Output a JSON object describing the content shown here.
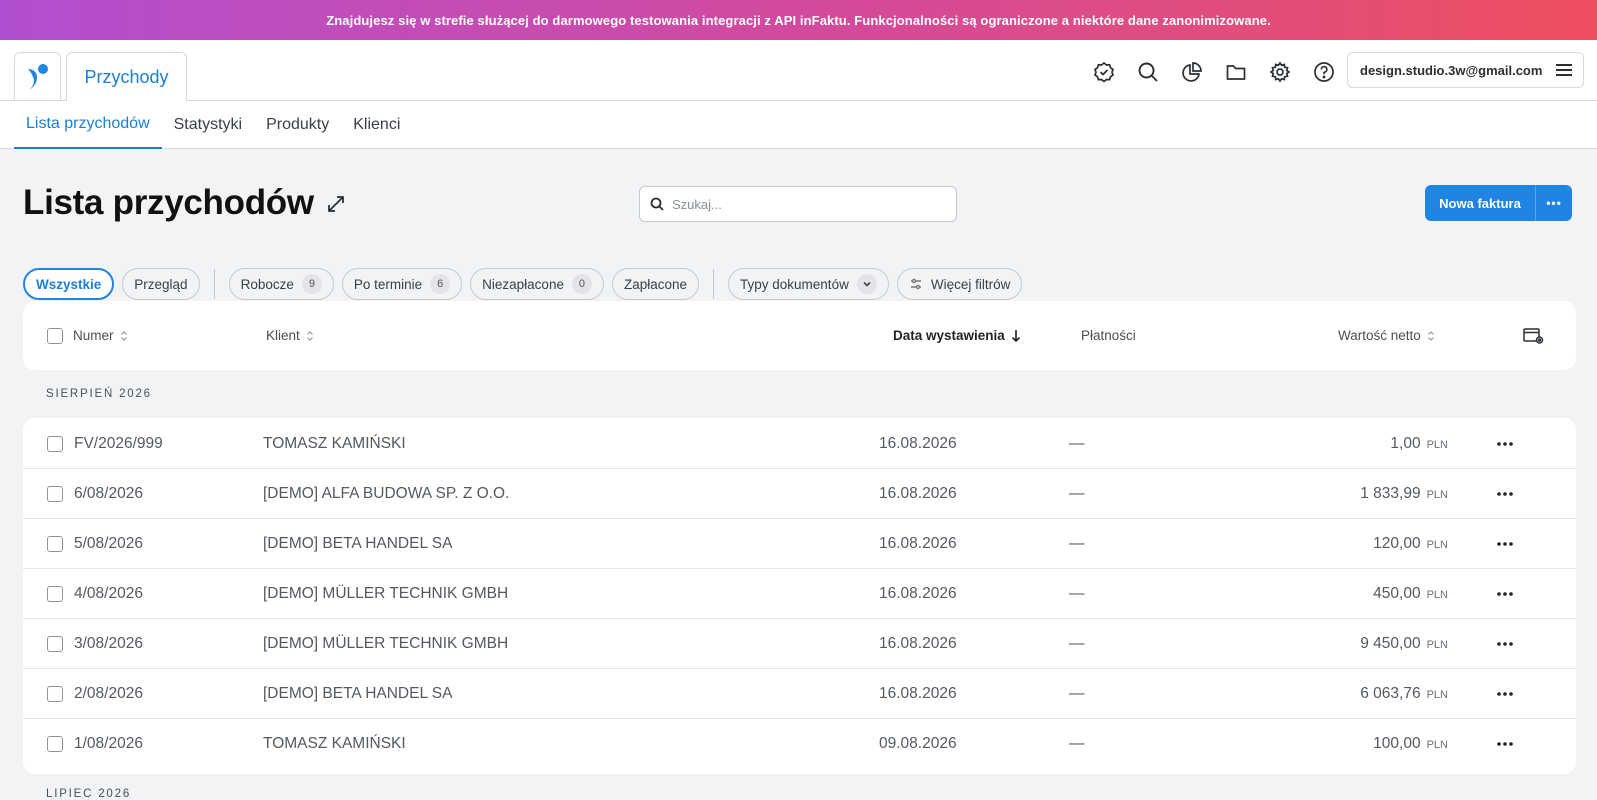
{
  "banner": {
    "text": "Znajdujesz się w strefie służącej do darmowego testowania integracji z API inFaktu. Funkcjonalności są ograniczone a niektóre dane zanonimizowane."
  },
  "topbar": {
    "app_tab": "Przychody",
    "icons": [
      "badge-check-icon",
      "search-icon",
      "pie-chart-icon",
      "folder-icon",
      "gear-icon",
      "help-icon"
    ],
    "user_email": "design.studio.3w@gmail.com"
  },
  "subnav": {
    "items": [
      {
        "label": "Lista przychodów",
        "active": true
      },
      {
        "label": "Statystyki",
        "active": false
      },
      {
        "label": "Produkty",
        "active": false
      },
      {
        "label": "Klienci",
        "active": false
      }
    ]
  },
  "page": {
    "title": "Lista przychodów",
    "search_placeholder": "Szukaj...",
    "new_invoice_button": "Nowa faktura",
    "more_button": "•••"
  },
  "filters": {
    "all": "Wszystkie",
    "overview": "Przegląd",
    "drafts": {
      "label": "Robocze",
      "count": "9"
    },
    "overdue": {
      "label": "Po terminie",
      "count": "6"
    },
    "unpaid": {
      "label": "Niezapłacone",
      "count": "0"
    },
    "paid": "Zapłacone",
    "doc_types": "Typy dokumentów",
    "more_filters": "Więcej filtrów"
  },
  "table": {
    "headers": {
      "number": "Numer",
      "client": "Klient",
      "issue_date": "Data wystawienia",
      "payments": "Płatności",
      "net_value": "Wartość netto"
    },
    "group_label": "SIERPIEŃ 2026",
    "next_group_label": "LIPIEC 2026",
    "rows": [
      {
        "number": "FV/2026/999",
        "client": "TOMASZ KAMIŃSKI",
        "date": "16.08.2026",
        "payment": "—",
        "value": "1,00",
        "currency": "PLN"
      },
      {
        "number": "6/08/2026",
        "client": "[DEMO] ALFA BUDOWA SP. Z O.O.",
        "date": "16.08.2026",
        "payment": "—",
        "value": "1 833,99",
        "currency": "PLN"
      },
      {
        "number": "5/08/2026",
        "client": "[DEMO] BETA HANDEL SA",
        "date": "16.08.2026",
        "payment": "—",
        "value": "120,00",
        "currency": "PLN"
      },
      {
        "number": "4/08/2026",
        "client": "[DEMO] MÜLLER TECHNIK GMBH",
        "date": "16.08.2026",
        "payment": "—",
        "value": "450,00",
        "currency": "PLN"
      },
      {
        "number": "3/08/2026",
        "client": "[DEMO] MÜLLER TECHNIK GMBH",
        "date": "16.08.2026",
        "payment": "—",
        "value": "9 450,00",
        "currency": "PLN"
      },
      {
        "number": "2/08/2026",
        "client": "[DEMO] BETA HANDEL SA",
        "date": "16.08.2026",
        "payment": "—",
        "value": "6 063,76",
        "currency": "PLN"
      },
      {
        "number": "1/08/2026",
        "client": "TOMASZ KAMIŃSKI",
        "date": "09.08.2026",
        "payment": "—",
        "value": "100,00",
        "currency": "PLN"
      }
    ]
  },
  "colors": {
    "accent": "#1f84e2",
    "banner_start": "#b24fd0",
    "banner_end": "#ee4f5f"
  }
}
